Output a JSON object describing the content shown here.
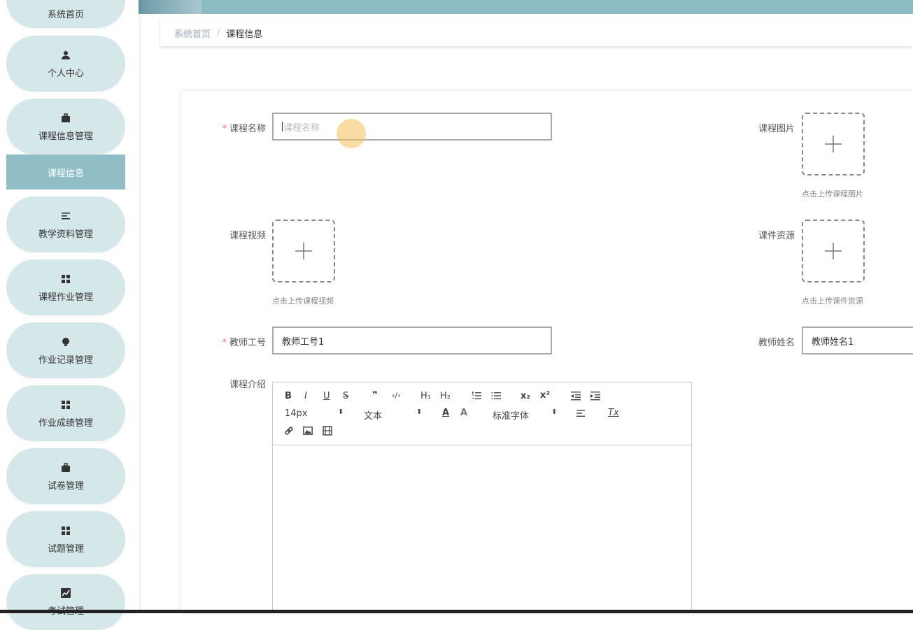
{
  "sidebar": {
    "items": [
      {
        "label": "系统首页",
        "icon": "home-icon"
      },
      {
        "label": "个人中心",
        "icon": "user-icon"
      },
      {
        "label": "课程信息管理",
        "icon": "briefcase-icon"
      },
      {
        "label": "教学资料管理",
        "icon": "list-icon"
      },
      {
        "label": "课程作业管理",
        "icon": "grid-icon"
      },
      {
        "label": "作业记录管理",
        "icon": "bulb-icon"
      },
      {
        "label": "作业成绩管理",
        "icon": "grid-icon"
      },
      {
        "label": "试卷管理",
        "icon": "briefcase-icon"
      },
      {
        "label": "试题管理",
        "icon": "grid-icon"
      },
      {
        "label": "考试管理",
        "icon": "chart-icon"
      }
    ],
    "active_sub": "课程信息"
  },
  "breadcrumb": {
    "home": "系统首页",
    "separator": "/",
    "current": "课程信息"
  },
  "form": {
    "course_name": {
      "label": "课程名称",
      "required": "*",
      "placeholder": "课程名称",
      "value": ""
    },
    "course_image": {
      "label": "课程图片",
      "hint": "点击上传课程图片"
    },
    "course_video": {
      "label": "课程视频",
      "hint": "点击上传课程视频"
    },
    "courseware": {
      "label": "课件资源",
      "hint": "点击上传课件资源"
    },
    "teacher_id": {
      "label": "教师工号",
      "required": "*",
      "value": "教师工号1"
    },
    "teacher_name": {
      "label": "教师姓名",
      "value": "教师姓名1"
    },
    "course_intro": {
      "label": "课程介绍"
    }
  },
  "editor_toolbar": {
    "bold": "B",
    "italic": "I",
    "underline": "U",
    "strike": "S",
    "quote": "❞",
    "code": "‹/›",
    "h1": "H₁",
    "h2": "H₂",
    "sub": "x₂",
    "sup": "x²",
    "size": "14px",
    "type": "文本",
    "font": "标准字体",
    "clear_format": "Tx"
  },
  "colors": {
    "nav_bg": "#d6e7ea",
    "nav_active": "#8fbec6",
    "header": "#8bbcc3",
    "required": "#f56c6c"
  }
}
